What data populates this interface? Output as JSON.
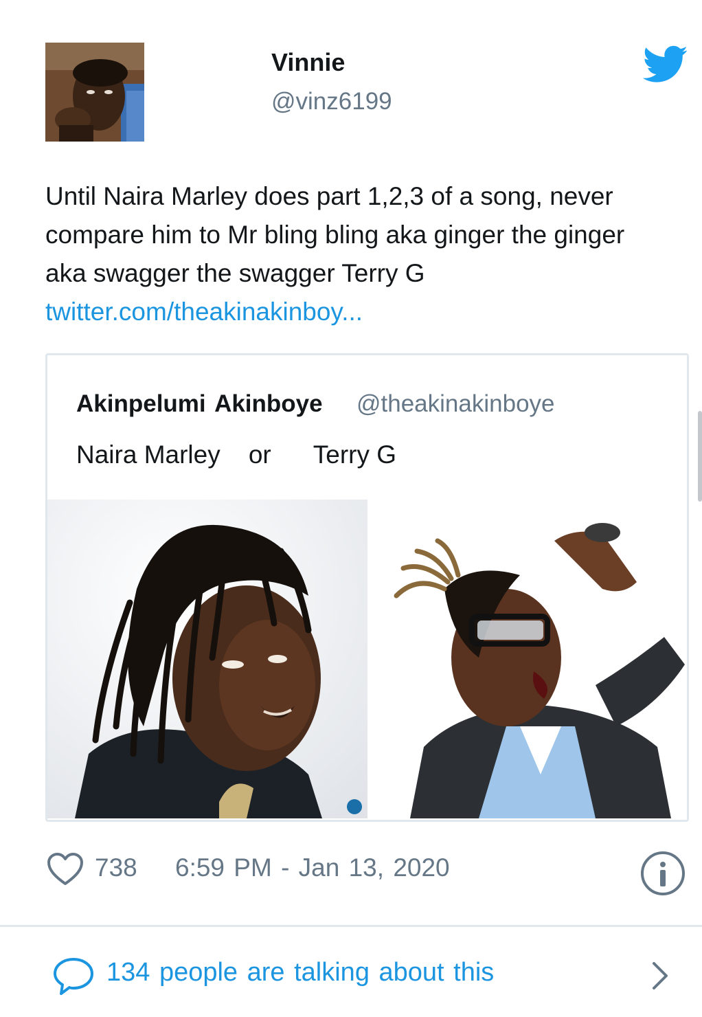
{
  "author": {
    "display_name": "Vinnie",
    "handle": "@vinz6199",
    "avatar_icon": "user-photo-icon"
  },
  "tweet": {
    "text": "Until Naira Marley does part 1,2,3 of a song, never compare him to Mr bling bling aka ginger the ginger aka swagger the swagger Terry G",
    "link": "twitter.com/theakinakinboy..."
  },
  "quoted_tweet": {
    "display_name": "Akinpelumi  Akinboye",
    "handle": "@theakinakinboye",
    "text": "Naira Marley    or      Terry G",
    "images": [
      "photo-naira-marley",
      "photo-terry-g"
    ]
  },
  "footer": {
    "like_count": "738",
    "timestamp": "6:59 PM - Jan 13, 2020"
  },
  "talking": {
    "label": "134 people are talking about this"
  },
  "colors": {
    "brand": "#1da1f2",
    "link": "#1b95e0",
    "secondary_text": "#657786",
    "border": "#e1e8ed"
  }
}
